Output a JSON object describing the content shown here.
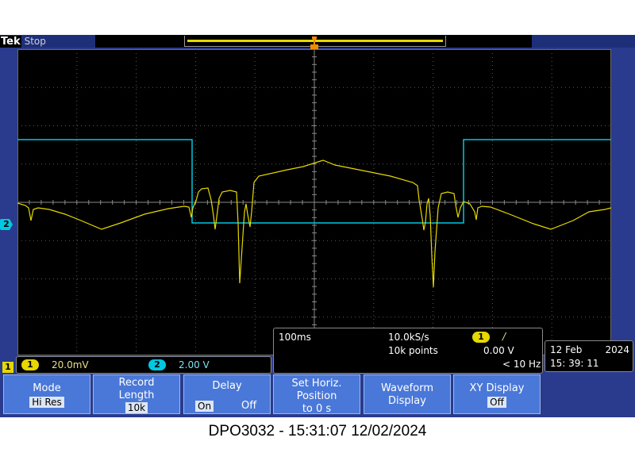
{
  "status": {
    "brand": "Tek",
    "state": "Stop"
  },
  "channels": {
    "ch1": {
      "number": "1",
      "scale": "20.0mV",
      "color": "#e6d800"
    },
    "ch2": {
      "number": "2",
      "scale": "2.00 V",
      "color": "#00c8e0"
    }
  },
  "horizontal": {
    "time_div": "100ms",
    "sample_rate": "10.0kS/s",
    "record_points": "10k points"
  },
  "trigger": {
    "source": "1",
    "slope": "/",
    "level": "0.00 V",
    "frequency": "< 10 Hz"
  },
  "datetime": {
    "day_month": "12 Feb",
    "year": "2024",
    "time": "15: 39: 11"
  },
  "softkeys": {
    "mode": {
      "line1": "Mode",
      "value": "Hi Res"
    },
    "record": {
      "line1": "Record",
      "line2": "Length",
      "value": "10k"
    },
    "delay": {
      "line1": "Delay",
      "on": "On",
      "off": "Off"
    },
    "horiz": {
      "line1": "Set Horiz.",
      "line2": "Position",
      "line3": "to 0 s"
    },
    "waveform": {
      "line1": "Waveform",
      "line2": "Display"
    },
    "xy": {
      "line1": "XY Display",
      "value": "Off"
    }
  },
  "caption": "DPO3032 - 15:31:07    12/02/2024"
}
